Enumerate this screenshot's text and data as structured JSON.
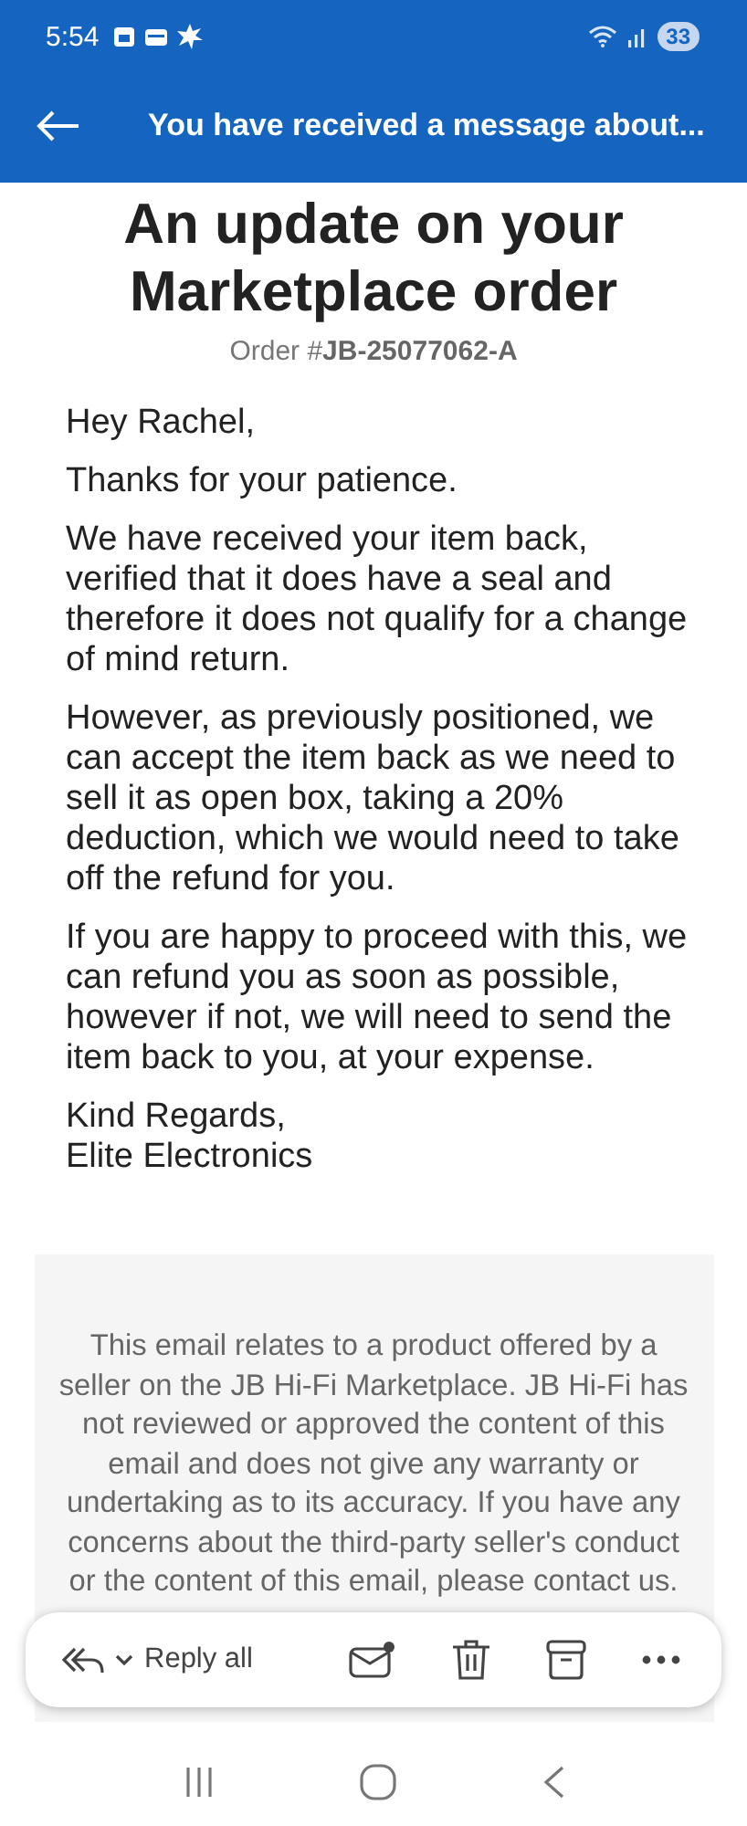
{
  "status_bar": {
    "time": "5:54",
    "battery": "33"
  },
  "app_bar": {
    "title": "You have received a message about..."
  },
  "email": {
    "title": "An update on your Marketplace order",
    "order_label": "Order #",
    "order_number": "JB-25077062-A",
    "paragraphs": [
      "Hey Rachel,",
      "Thanks for your patience.",
      "We have received your item back, verified that it does have a seal and therefore it does not qualify for a change of mind return.",
      "However, as previously positioned, we can accept the item back as we need to sell it as open box, taking a 20% deduction, which we would need to take off the refund for you.",
      "If you are happy to proceed with this, we can refund you as soon as possible, however if not, we will need to send the item back to you, at your expense."
    ],
    "signoff": [
      "Kind Regards,",
      "Elite Electronics"
    ],
    "footer": "This email relates to a product offered by a seller on the JB Hi-Fi Marketplace. JB Hi-Fi has not reviewed or approved the content of this email and does not give any warranty or undertaking as to its accuracy. If you have any concerns about the third-party seller's conduct or the content of this email, please contact us."
  },
  "toolbar": {
    "reply_label": "Reply all"
  }
}
